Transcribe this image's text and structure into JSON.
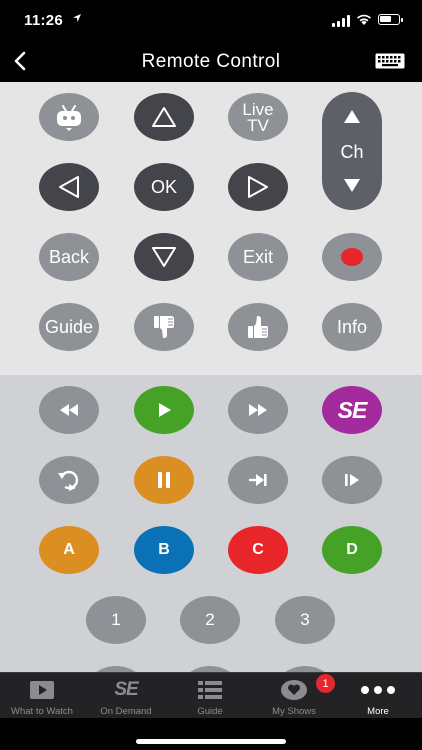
{
  "status_bar": {
    "time": "11:26"
  },
  "header": {
    "title": "Remote Control",
    "back_icon": "chevron-left-icon",
    "keyboard_icon": "keyboard-icon"
  },
  "remote_top": {
    "tivo_icon": "tivo-logo-icon",
    "live_tv": "Live\nTV",
    "channel": "Ch",
    "ok": "OK",
    "back": "Back",
    "exit": "Exit",
    "guide": "Guide",
    "info": "Info"
  },
  "remote_bottom": {
    "skip_label": "SE",
    "color_buttons": {
      "a": "A",
      "b": "B",
      "c": "C",
      "d": "D"
    },
    "numbers": [
      "1",
      "2",
      "3"
    ]
  },
  "colors": {
    "green": "#46a127",
    "orange": "#db8e22",
    "blue": "#0a71b6",
    "red": "#e8262a",
    "purple": "#a22a9d",
    "record": "#e8262a"
  },
  "tab_bar": {
    "tabs": [
      {
        "label": "What to Watch",
        "icon": "play-tv-icon"
      },
      {
        "label": "On Demand",
        "icon": "se-icon"
      },
      {
        "label": "Guide",
        "icon": "list-icon"
      },
      {
        "label": "My Shows",
        "icon": "heart-tv-icon"
      },
      {
        "label": "More",
        "icon": "more-dots-icon"
      }
    ],
    "badge": "1"
  }
}
